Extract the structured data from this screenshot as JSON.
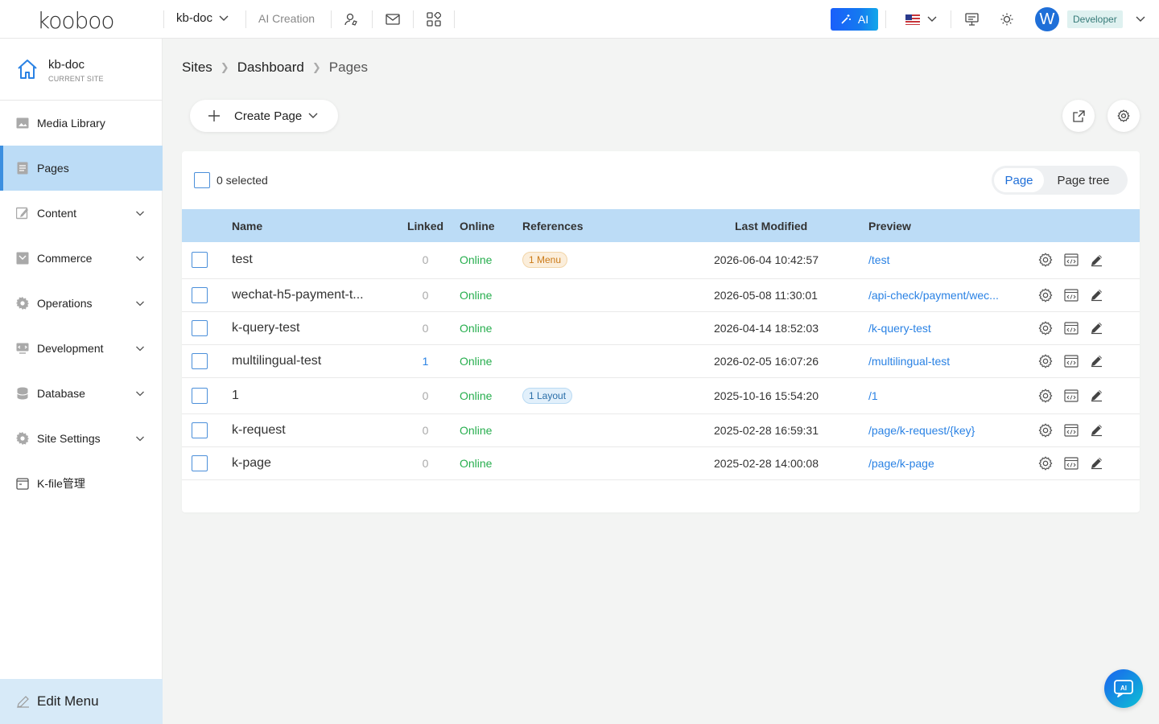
{
  "app": {
    "logo_text": "kooboo",
    "site_selector": "kb-doc",
    "ai_creation": "AI Creation",
    "ai_button": "AI",
    "avatar_letter": "W",
    "role": "Developer"
  },
  "sidebar": {
    "site_name": "kb-doc",
    "site_sub": "CURRENT SITE",
    "items": [
      {
        "label": "Media Library",
        "icon": "image-icon",
        "expandable": false
      },
      {
        "label": "Pages",
        "icon": "page-icon",
        "expandable": false,
        "active": true
      },
      {
        "label": "Content",
        "icon": "content-icon",
        "expandable": true
      },
      {
        "label": "Commerce",
        "icon": "commerce-icon",
        "expandable": true
      },
      {
        "label": "Operations",
        "icon": "gear-icon",
        "expandable": true
      },
      {
        "label": "Development",
        "icon": "code-icon",
        "expandable": true
      },
      {
        "label": "Database",
        "icon": "database-icon",
        "expandable": true
      },
      {
        "label": "Site Settings",
        "icon": "gear-icon",
        "expandable": true
      },
      {
        "label": "K-file管理",
        "icon": "folder-icon",
        "expandable": false
      }
    ],
    "edit_menu": "Edit Menu"
  },
  "breadcrumb": [
    "Sites",
    "Dashboard",
    "Pages"
  ],
  "toolbar": {
    "create_page": "Create Page"
  },
  "table": {
    "selected_text": "0 selected",
    "view_toggle": {
      "active": "Page",
      "inactive": "Page tree"
    },
    "columns": [
      "Name",
      "Linked",
      "Online",
      "References",
      "Last Modified",
      "Preview"
    ],
    "rows": [
      {
        "name": "test",
        "linked": "0",
        "online": "Online",
        "reference": "1 Menu",
        "ref_color": "orange",
        "modified": "2026-06-04 10:42:57",
        "preview": "/test"
      },
      {
        "name": "wechat-h5-payment-t...",
        "linked": "0",
        "online": "Online",
        "reference": "",
        "ref_color": "",
        "modified": "2026-05-08 11:30:01",
        "preview": "/api-check/payment/wec..."
      },
      {
        "name": "k-query-test",
        "linked": "0",
        "online": "Online",
        "reference": "",
        "ref_color": "",
        "modified": "2026-04-14 18:52:03",
        "preview": "/k-query-test"
      },
      {
        "name": "multilingual-test",
        "linked": "1",
        "online": "Online",
        "reference": "",
        "ref_color": "",
        "modified": "2026-02-05 16:07:26",
        "preview": "/multilingual-test"
      },
      {
        "name": "1",
        "linked": "0",
        "online": "Online",
        "reference": "1 Layout",
        "ref_color": "blue",
        "modified": "2025-10-16 15:54:20",
        "preview": "/1"
      },
      {
        "name": "k-request",
        "linked": "0",
        "online": "Online",
        "reference": "",
        "ref_color": "",
        "modified": "2025-02-28 16:59:31",
        "preview": "/page/k-request/{key}"
      },
      {
        "name": "k-page",
        "linked": "0",
        "online": "Online",
        "reference": "",
        "ref_color": "",
        "modified": "2025-02-28 14:00:08",
        "preview": "/page/k-page"
      }
    ]
  }
}
